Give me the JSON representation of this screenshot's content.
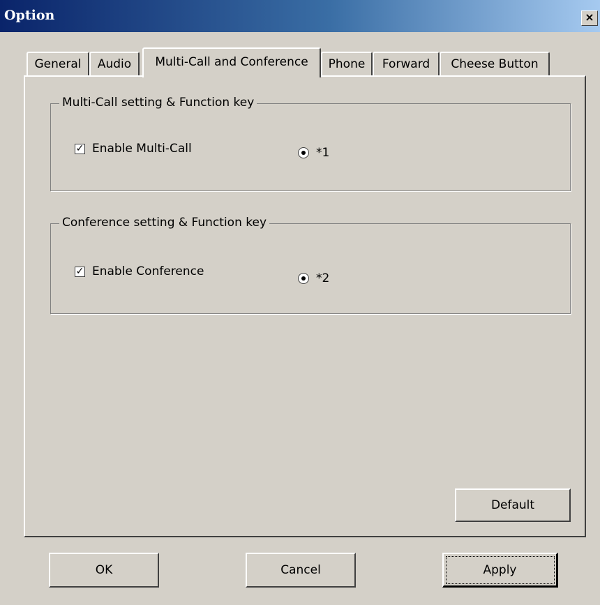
{
  "window": {
    "title": "Option",
    "close_glyph": "×"
  },
  "tabs": [
    {
      "label": "General",
      "active": false
    },
    {
      "label": "Audio",
      "active": false
    },
    {
      "label": "Multi-Call and Conference",
      "active": true
    },
    {
      "label": "Phone",
      "active": false
    },
    {
      "label": "Forward",
      "active": false
    },
    {
      "label": "Cheese Button",
      "active": false
    }
  ],
  "multicall_group": {
    "legend": "Multi-Call setting & Function key",
    "checkbox_label": "Enable Multi-Call",
    "checked": true,
    "radio_label": "*1",
    "radio_selected": true
  },
  "conference_group": {
    "legend": "Conference setting & Function key",
    "checkbox_label": "Enable Conference",
    "checked": true,
    "radio_label": "*2",
    "radio_selected": true
  },
  "buttons": {
    "default": "Default",
    "ok": "OK",
    "cancel": "Cancel",
    "apply": "Apply"
  },
  "check_glyph": "✓"
}
